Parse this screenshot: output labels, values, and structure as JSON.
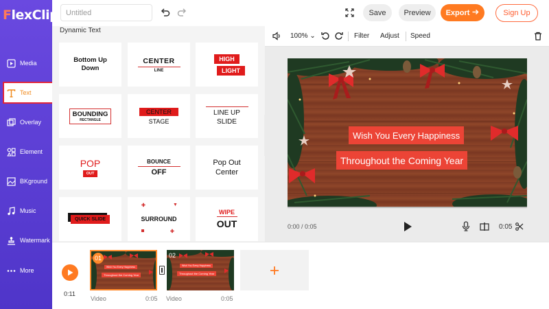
{
  "app": {
    "logo_prefix": "F",
    "logo_rest": "lexClip"
  },
  "sidebar": {
    "items": [
      {
        "label": "Media",
        "icon": "media-icon",
        "active": false
      },
      {
        "label": "Text",
        "icon": "text-icon",
        "active": true
      },
      {
        "label": "Overlay",
        "icon": "overlay-icon",
        "active": false
      },
      {
        "label": "Element",
        "icon": "element-icon",
        "active": false
      },
      {
        "label": "BKground",
        "icon": "background-icon",
        "active": false
      },
      {
        "label": "Music",
        "icon": "music-icon",
        "active": false
      },
      {
        "label": "Watermark",
        "icon": "watermark-icon",
        "active": false
      },
      {
        "label": "More",
        "icon": "more-icon",
        "active": false
      }
    ]
  },
  "topbar": {
    "title_placeholder": "Untitled",
    "save_label": "Save",
    "preview_label": "Preview",
    "export_label": "Export",
    "signup_label": "Sign Up"
  },
  "panel": {
    "title": "Dynamic Text",
    "cards": {
      "c1": [
        "Bottom Up",
        "Down"
      ],
      "c2": [
        "CENTER",
        "LINE"
      ],
      "c3": [
        "HIGH",
        "LIGHT"
      ],
      "c4": [
        "BOUNDING",
        "RECTANGLE"
      ],
      "c5": [
        "CENTER",
        "STAGE"
      ],
      "c6": [
        "LINE UP",
        "SLIDE"
      ],
      "c7": [
        "POP",
        "OUT"
      ],
      "c8": [
        "BOUNCE",
        "OFF"
      ],
      "c9": [
        "Pop Out",
        "Center"
      ],
      "c10": [
        "QUICK SLIDE"
      ],
      "c11": [
        "SURROUND"
      ],
      "c12": [
        "WIPE",
        "OUT"
      ]
    }
  },
  "preview_toolbar": {
    "zoom": "100%",
    "filter_label": "Filter",
    "adjust_label": "Adjust",
    "speed_label": "Speed"
  },
  "canvas": {
    "caption_line1": "Wish You Every Happiness",
    "caption_line2": "Throughout the Coming Year"
  },
  "player": {
    "current_time": "0:00 / 0:05",
    "end_time": "0:05"
  },
  "timeline": {
    "total_time": "0:11",
    "clips": [
      {
        "number": "01",
        "type": "Video",
        "duration": "0:05",
        "selected": true
      },
      {
        "number": "02",
        "type": "Video",
        "duration": "0:05",
        "selected": false
      }
    ],
    "clip_caption_line1": "Wish You Every Happiness",
    "clip_caption_line2": "Throughout the Coming Year"
  },
  "colors": {
    "sidebar": "#5b3fd6",
    "accent": "#ff7a21",
    "caption_bg": "#ec4436"
  }
}
